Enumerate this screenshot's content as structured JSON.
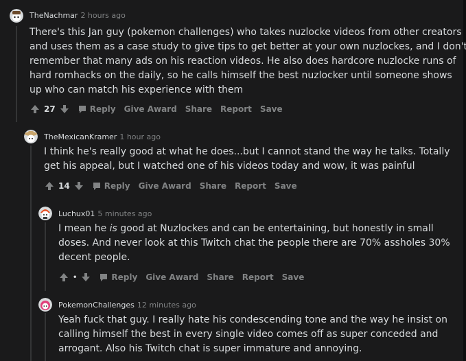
{
  "comments": [
    {
      "author": "TheNachmar",
      "time": "2 hours ago",
      "lines": [
        "There's this Jan guy (pokemon challenges) who takes nuzlocke videos from other creators",
        "and uses them as a case study to give tips to get better at your own nuzlockes, and I don't",
        "remember that many ads on his reaction videos. He also does hardcore nuzlocke runs of",
        "hard romhacks on the daily, so he calls himself the best nuzlocker until someone shows",
        "up who can match his experience with them"
      ],
      "score": "27",
      "actions": [
        "Reply",
        "Give Award",
        "Share",
        "Report",
        "Save"
      ]
    },
    {
      "author": "TheMexicanKramer",
      "time": "1 hour ago",
      "lines": [
        "I think he's really good at what he does...but I cannot stand the way he talks. Totally",
        "get his appeal, but I watched one of his videos today and wow, it was painful"
      ],
      "score": "14",
      "actions": [
        "Reply",
        "Give Award",
        "Share",
        "Report",
        "Save"
      ]
    },
    {
      "author": "Luchux01",
      "time": "5 minutes ago",
      "lines": [
        "I mean he ",
        "is",
        " good at Nuzlockes and can be entertaining, but honestly in small",
        "doses. And never look at this Twitch chat the people there are 70% assholes 30%",
        "decent people."
      ],
      "score": "•",
      "actions": [
        "Reply",
        "Give Award",
        "Share",
        "Report",
        "Save"
      ]
    },
    {
      "author": "PokemonChallenges",
      "time": "12 minutes ago",
      "lines": [
        "Yeah fuck that guy. I really hate his condescending tone and the way he insist on",
        "calling himself the best in every single video comes off as super conceded and",
        "arrogant. Also his Twitch chat is super immature and annoying."
      ]
    }
  ],
  "icons": {
    "upvote": "arrow-up-icon",
    "downvote": "arrow-down-icon",
    "reply": "speech-bubble-icon"
  },
  "colors": {
    "background": "#1a1a1b",
    "text": "#d7dadc",
    "muted": "#818384",
    "thread_line": "#343536"
  }
}
